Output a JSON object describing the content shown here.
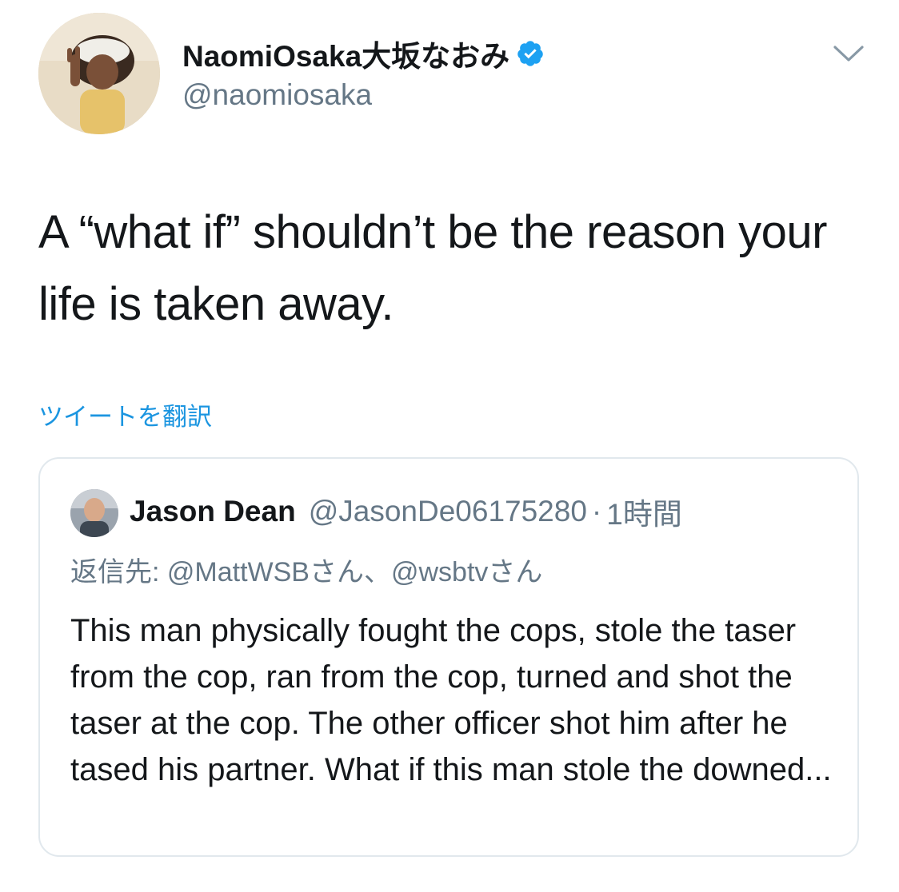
{
  "author": {
    "display_name": "NaomiOsaka大坂なおみ",
    "handle": "@naomiosaka",
    "verified": true
  },
  "tweet": {
    "text": "A “what if” shouldn’t be the reason your life is taken away.",
    "translate_label": "ツイートを翻訳"
  },
  "quoted_tweet": {
    "author_name": "Jason Dean",
    "author_handle": "@JasonDe06175280",
    "separator": "·",
    "time_ago": "1時間",
    "reply_to": "返信先: @MattWSBさん、@wsbtvさん",
    "text": "This man physically fought the cops, stole the taser from the cop, ran from the cop, turned and shot the taser at the cop. The other officer shot him after he tased his partner. What if this man stole the downed..."
  },
  "icons": {
    "menu": "chevron-down-icon",
    "verified": "verified-badge-icon"
  },
  "colors": {
    "text_primary": "#14171a",
    "text_secondary": "#657786",
    "link": "#1b95e0",
    "verified": "#1da1f2",
    "border": "#e1e8ed"
  }
}
